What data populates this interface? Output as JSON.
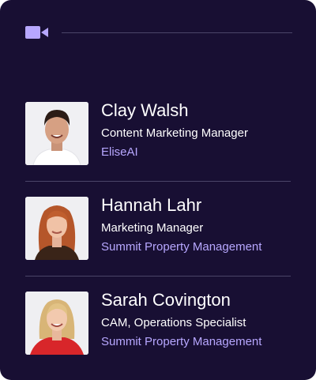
{
  "header": {
    "icon": "video-camera-icon",
    "accent_color": "#b7a7ff"
  },
  "speakers": [
    {
      "name": "Clay Walsh",
      "role": "Content Marketing Manager",
      "company": "EliseAI"
    },
    {
      "name": "Hannah Lahr",
      "role": "Marketing Manager",
      "company": "Summit Property Management"
    },
    {
      "name": "Sarah Covington",
      "role": "CAM, Operations Specialist",
      "company": "Summit Property Management"
    }
  ],
  "colors": {
    "background": "#180f33",
    "text": "#ffffff",
    "company_text": "#b7a7ff",
    "divider": "#4b4568"
  }
}
